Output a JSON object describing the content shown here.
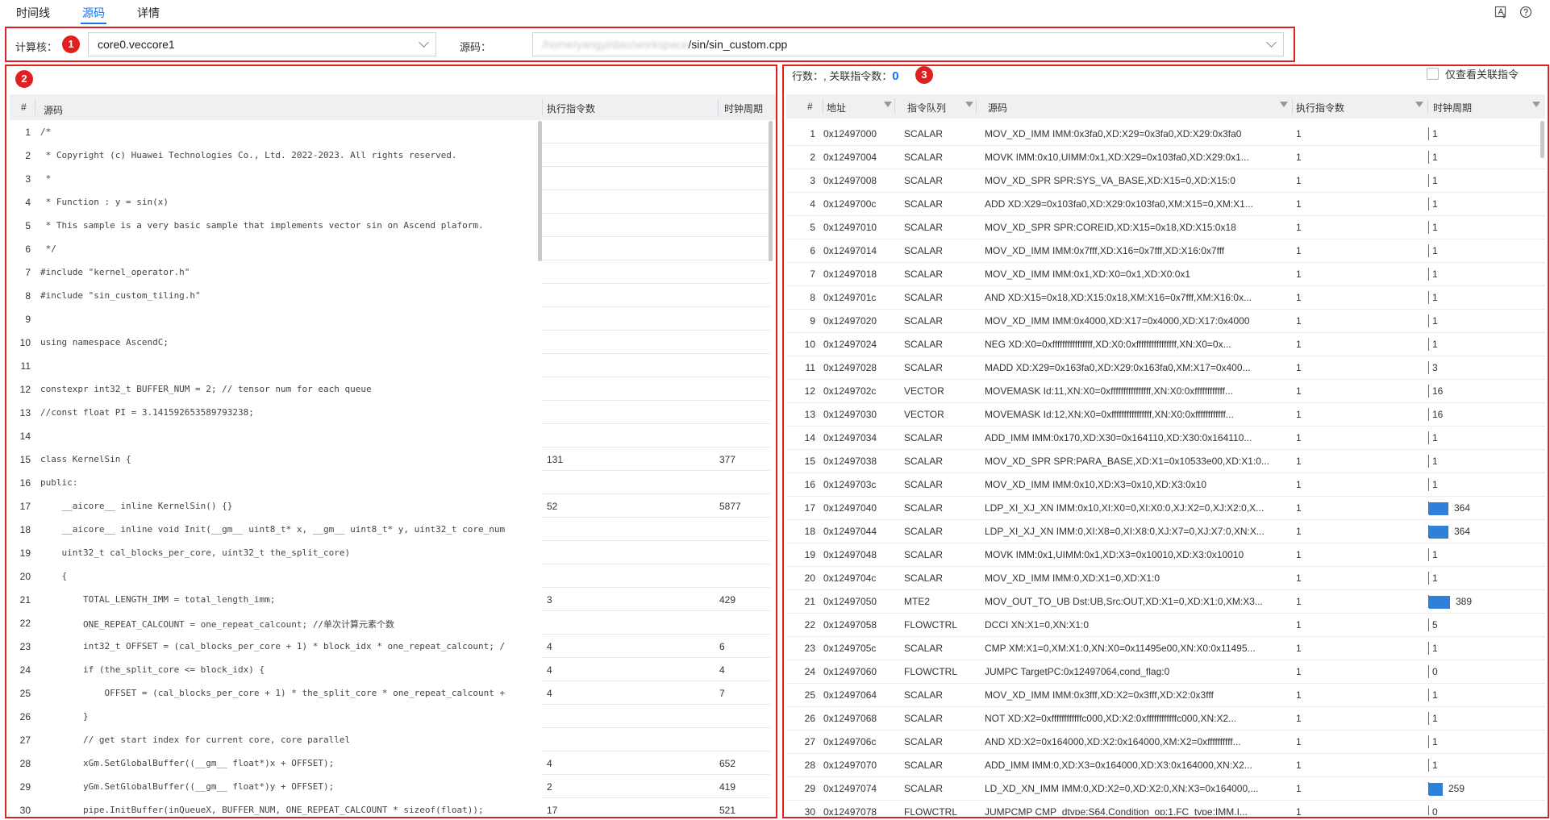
{
  "tabs": [
    {
      "label": "时间线"
    },
    {
      "label": "源码"
    },
    {
      "label": "详情"
    }
  ],
  "toolbar_icons": [
    "export-icon",
    "help-icon"
  ],
  "filters": {
    "core_label": "计算核：",
    "core_value": "core0.veccore1",
    "source_label": "源码：",
    "source_path_blurred": "/home/yangyi/dao/workspace",
    "source_path_suffix": "/sin/sin_custom.cpp"
  },
  "badges": [
    "1",
    "2",
    "3"
  ],
  "source_panel": {
    "headers": {
      "num": "#",
      "code": "源码",
      "exec": "执行指令数",
      "cycles": "时钟周期"
    },
    "rows": [
      {
        "n": "1",
        "code": "/*",
        "ex": "",
        "cy": ""
      },
      {
        "n": "2",
        "code": " * Copyright (c) Huawei Technologies Co., Ltd. 2022-2023. All rights reserved.",
        "ex": "",
        "cy": ""
      },
      {
        "n": "3",
        "code": " *",
        "ex": "",
        "cy": ""
      },
      {
        "n": "4",
        "code": " * Function : y = sin(x)",
        "ex": "",
        "cy": ""
      },
      {
        "n": "5",
        "code": " * This sample is a very basic sample that implements vector sin on Ascend plaform.",
        "ex": "",
        "cy": ""
      },
      {
        "n": "6",
        "code": " */",
        "ex": "",
        "cy": ""
      },
      {
        "n": "7",
        "code": "#include \"kernel_operator.h\"",
        "ex": "",
        "cy": ""
      },
      {
        "n": "8",
        "code": "#include \"sin_custom_tiling.h\"",
        "ex": "",
        "cy": ""
      },
      {
        "n": "9",
        "code": "",
        "ex": "",
        "cy": ""
      },
      {
        "n": "10",
        "code": "using namespace AscendC;",
        "ex": "",
        "cy": ""
      },
      {
        "n": "11",
        "code": "",
        "ex": "",
        "cy": ""
      },
      {
        "n": "12",
        "code": "constexpr int32_t BUFFER_NUM = 2; // tensor num for each queue",
        "ex": "",
        "cy": ""
      },
      {
        "n": "13",
        "code": "//const float PI = 3.141592653589793238;",
        "ex": "",
        "cy": ""
      },
      {
        "n": "14",
        "code": "",
        "ex": "",
        "cy": ""
      },
      {
        "n": "15",
        "code": "class KernelSin {",
        "ex": "131",
        "cy": "377"
      },
      {
        "n": "16",
        "code": "public:",
        "ex": "",
        "cy": ""
      },
      {
        "n": "17",
        "code": "    __aicore__ inline KernelSin() {}",
        "ex": "52",
        "cy": "5877"
      },
      {
        "n": "18",
        "code": "    __aicore__ inline void Init(__gm__ uint8_t* x, __gm__ uint8_t* y, uint32_t core_num",
        "ex": "",
        "cy": ""
      },
      {
        "n": "19",
        "code": "    uint32_t cal_blocks_per_core, uint32_t the_split_core)",
        "ex": "",
        "cy": ""
      },
      {
        "n": "20",
        "code": "    {",
        "ex": "",
        "cy": ""
      },
      {
        "n": "21",
        "code": "        TOTAL_LENGTH_IMM = total_length_imm;",
        "ex": "3",
        "cy": "429"
      },
      {
        "n": "22",
        "code": "        ONE_REPEAT_CALCOUNT = one_repeat_calcount; //单次计算元素个数",
        "ex": "",
        "cy": ""
      },
      {
        "n": "23",
        "code": "        int32_t OFFSET = (cal_blocks_per_core + 1) * block_idx * one_repeat_calcount; /",
        "ex": "4",
        "cy": "6"
      },
      {
        "n": "24",
        "code": "        if (the_split_core <= block_idx) {",
        "ex": "4",
        "cy": "4"
      },
      {
        "n": "25",
        "code": "            OFFSET = (cal_blocks_per_core + 1) * the_split_core * one_repeat_calcount +",
        "ex": "4",
        "cy": "7"
      },
      {
        "n": "26",
        "code": "        }",
        "ex": "",
        "cy": ""
      },
      {
        "n": "27",
        "code": "        // get start index for current core, core parallel",
        "ex": "",
        "cy": ""
      },
      {
        "n": "28",
        "code": "        xGm.SetGlobalBuffer((__gm__ float*)x + OFFSET);",
        "ex": "4",
        "cy": "652"
      },
      {
        "n": "29",
        "code": "        yGm.SetGlobalBuffer((__gm__ float*)y + OFFSET);",
        "ex": "2",
        "cy": "419"
      },
      {
        "n": "30",
        "code": "        pipe.InitBuffer(inQueueX, BUFFER_NUM, ONE_REPEAT_CALCOUNT * sizeof(float));",
        "ex": "17",
        "cy": "521"
      }
    ]
  },
  "instr_panel": {
    "title": "行数：, 关联指令数：",
    "count": "0",
    "only_related_label": "仅查看关联指令",
    "headers": {
      "num": "#",
      "addr": "地址",
      "queue": "指令队列",
      "src": "源码",
      "exec": "执行指令数",
      "cycles": "时钟周期"
    },
    "rows": [
      {
        "n": "1",
        "addr": "0x12497000",
        "q": "SCALAR",
        "src": "MOV_XD_IMM IMM:0x3fa0,XD:X29=0x3fa0,XD:X29:0x3fa0",
        "ex": "1",
        "cy": "1",
        "cyc": 1
      },
      {
        "n": "2",
        "addr": "0x12497004",
        "q": "SCALAR",
        "src": "MOVK IMM:0x10,UIMM:0x1,XD:X29=0x103fa0,XD:X29:0x1...",
        "ex": "1",
        "cy": "1",
        "cyc": 1
      },
      {
        "n": "3",
        "addr": "0x12497008",
        "q": "SCALAR",
        "src": "MOV_XD_SPR SPR:SYS_VA_BASE,XD:X15=0,XD:X15:0",
        "ex": "1",
        "cy": "1",
        "cyc": 1
      },
      {
        "n": "4",
        "addr": "0x1249700c",
        "q": "SCALAR",
        "src": "ADD XD:X29=0x103fa0,XD:X29:0x103fa0,XM:X15=0,XM:X1...",
        "ex": "1",
        "cy": "1",
        "cyc": 1
      },
      {
        "n": "5",
        "addr": "0x12497010",
        "q": "SCALAR",
        "src": "MOV_XD_SPR SPR:COREID,XD:X15=0x18,XD:X15:0x18",
        "ex": "1",
        "cy": "1",
        "cyc": 1
      },
      {
        "n": "6",
        "addr": "0x12497014",
        "q": "SCALAR",
        "src": "MOV_XD_IMM IMM:0x7fff,XD:X16=0x7fff,XD:X16:0x7fff",
        "ex": "1",
        "cy": "1",
        "cyc": 1
      },
      {
        "n": "7",
        "addr": "0x12497018",
        "q": "SCALAR",
        "src": "MOV_XD_IMM IMM:0x1,XD:X0=0x1,XD:X0:0x1",
        "ex": "1",
        "cy": "1",
        "cyc": 1
      },
      {
        "n": "8",
        "addr": "0x1249701c",
        "q": "SCALAR",
        "src": "AND XD:X15=0x18,XD:X15:0x18,XM:X16=0x7fff,XM:X16:0x...",
        "ex": "1",
        "cy": "1",
        "cyc": 1
      },
      {
        "n": "9",
        "addr": "0x12497020",
        "q": "SCALAR",
        "src": "MOV_XD_IMM IMM:0x4000,XD:X17=0x4000,XD:X17:0x4000",
        "ex": "1",
        "cy": "1",
        "cyc": 1
      },
      {
        "n": "10",
        "addr": "0x12497024",
        "q": "SCALAR",
        "src": "NEG XD:X0=0xffffffffffffffff,XD:X0:0xffffffffffffffff,XN:X0=0x...",
        "ex": "1",
        "cy": "1",
        "cyc": 1
      },
      {
        "n": "11",
        "addr": "0x12497028",
        "q": "SCALAR",
        "src": "MADD XD:X29=0x163fa0,XD:X29:0x163fa0,XM:X17=0x400...",
        "ex": "1",
        "cy": "3",
        "cyc": 3
      },
      {
        "n": "12",
        "addr": "0x1249702c",
        "q": "VECTOR",
        "src": "MOVEMASK Id:11,XN:X0=0xffffffffffffffff,XN:X0:0xffffffffffff...",
        "ex": "1",
        "cy": "16",
        "cyc": 16
      },
      {
        "n": "13",
        "addr": "0x12497030",
        "q": "VECTOR",
        "src": "MOVEMASK Id:12,XN:X0=0xffffffffffffffff,XN:X0:0xffffffffffff...",
        "ex": "1",
        "cy": "16",
        "cyc": 16
      },
      {
        "n": "14",
        "addr": "0x12497034",
        "q": "SCALAR",
        "src": "ADD_IMM IMM:0x170,XD:X30=0x164110,XD:X30:0x164110...",
        "ex": "1",
        "cy": "1",
        "cyc": 1
      },
      {
        "n": "15",
        "addr": "0x12497038",
        "q": "SCALAR",
        "src": "MOV_XD_SPR SPR:PARA_BASE,XD:X1=0x10533e00,XD:X1:0...",
        "ex": "1",
        "cy": "1",
        "cyc": 1
      },
      {
        "n": "16",
        "addr": "0x1249703c",
        "q": "SCALAR",
        "src": "MOV_XD_IMM IMM:0x10,XD:X3=0x10,XD:X3:0x10",
        "ex": "1",
        "cy": "1",
        "cyc": 1
      },
      {
        "n": "17",
        "addr": "0x12497040",
        "q": "SCALAR",
        "src": "LDP_XI_XJ_XN IMM:0x10,XI:X0=0,XI:X0:0,XJ:X2=0,XJ:X2:0,X...",
        "ex": "1",
        "cy": "364",
        "cyc": 364
      },
      {
        "n": "18",
        "addr": "0x12497044",
        "q": "SCALAR",
        "src": "LDP_XI_XJ_XN IMM:0,XI:X8=0,XI:X8:0,XJ:X7=0,XJ:X7:0,XN:X...",
        "ex": "1",
        "cy": "364",
        "cyc": 364
      },
      {
        "n": "19",
        "addr": "0x12497048",
        "q": "SCALAR",
        "src": "MOVK IMM:0x1,UIMM:0x1,XD:X3=0x10010,XD:X3:0x10010",
        "ex": "1",
        "cy": "1",
        "cyc": 1
      },
      {
        "n": "20",
        "addr": "0x1249704c",
        "q": "SCALAR",
        "src": "MOV_XD_IMM IMM:0,XD:X1=0,XD:X1:0",
        "ex": "1",
        "cy": "1",
        "cyc": 1
      },
      {
        "n": "21",
        "addr": "0x12497050",
        "q": "MTE2",
        "src": "MOV_OUT_TO_UB Dst:UB,Src:OUT,XD:X1=0,XD:X1:0,XM:X3...",
        "ex": "1",
        "cy": "389",
        "cyc": 389
      },
      {
        "n": "22",
        "addr": "0x12497058",
        "q": "FLOWCTRL",
        "src": "DCCI XN:X1=0,XN:X1:0",
        "ex": "1",
        "cy": "5",
        "cyc": 5
      },
      {
        "n": "23",
        "addr": "0x1249705c",
        "q": "SCALAR",
        "src": "CMP XM:X1=0,XM:X1:0,XN:X0=0x11495e00,XN:X0:0x11495...",
        "ex": "1",
        "cy": "1",
        "cyc": 1
      },
      {
        "n": "24",
        "addr": "0x12497060",
        "q": "FLOWCTRL",
        "src": "JUMPC TargetPC:0x12497064,cond_flag:0",
        "ex": "1",
        "cy": "0",
        "cyc": 0
      },
      {
        "n": "25",
        "addr": "0x12497064",
        "q": "SCALAR",
        "src": "MOV_XD_IMM IMM:0x3fff,XD:X2=0x3fff,XD:X2:0x3fff",
        "ex": "1",
        "cy": "1",
        "cyc": 1
      },
      {
        "n": "26",
        "addr": "0x12497068",
        "q": "SCALAR",
        "src": "NOT XD:X2=0xffffffffffffc000,XD:X2:0xffffffffffffc000,XN:X2...",
        "ex": "1",
        "cy": "1",
        "cyc": 1
      },
      {
        "n": "27",
        "addr": "0x1249706c",
        "q": "SCALAR",
        "src": "AND XD:X2=0x164000,XD:X2:0x164000,XM:X2=0xffffffffff...",
        "ex": "1",
        "cy": "1",
        "cyc": 1
      },
      {
        "n": "28",
        "addr": "0x12497070",
        "q": "SCALAR",
        "src": "ADD_IMM IMM:0,XD:X3=0x164000,XD:X3:0x164000,XN:X2...",
        "ex": "1",
        "cy": "1",
        "cyc": 1
      },
      {
        "n": "29",
        "addr": "0x12497074",
        "q": "SCALAR",
        "src": "LD_XD_XN_IMM IMM:0,XD:X2=0,XD:X2:0,XN:X3=0x164000,...",
        "ex": "1",
        "cy": "259",
        "cyc": 259
      },
      {
        "n": "30",
        "addr": "0x12497078",
        "q": "FLOWCTRL",
        "src": "JUMPCMP CMP_dtype:S64,Condition_op:1,FC_type:IMM,I...",
        "ex": "1",
        "cy": "0",
        "cyc": 0
      }
    ]
  },
  "colors": {
    "accent": "#1a73e8",
    "highlight": "#e02020",
    "bar": "#2f80d9"
  }
}
